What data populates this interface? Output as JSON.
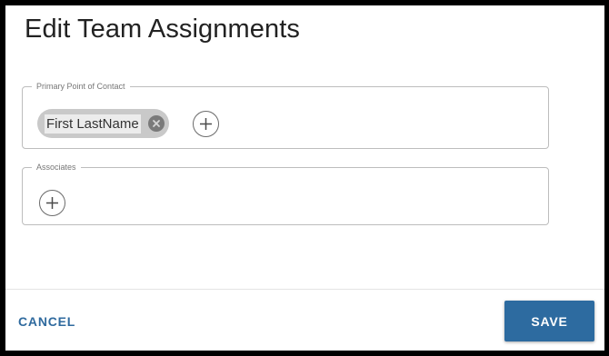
{
  "dialog": {
    "title": "Edit Team Assignments"
  },
  "primary_contact": {
    "legend": "Primary Point of Contact",
    "chips": [
      {
        "label": "First LastName"
      }
    ]
  },
  "associates": {
    "legend": "Associates"
  },
  "footer": {
    "cancel_label": "CANCEL",
    "save_label": "SAVE"
  },
  "colors": {
    "accent": "#2d6ba0",
    "chip_background": "#c9c9c9",
    "border": "#bdbdbd"
  },
  "icons": {
    "chip_remove": "close-circle-icon",
    "add": "plus-circle-icon"
  }
}
